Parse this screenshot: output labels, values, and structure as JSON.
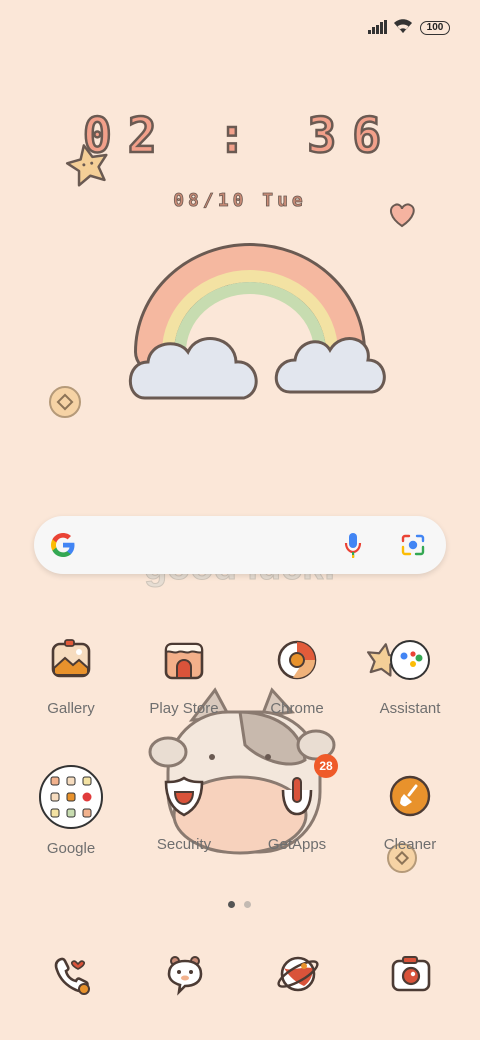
{
  "status_bar": {
    "battery": "100",
    "icons": [
      "signal-icon",
      "wifi-icon",
      "battery-icon"
    ]
  },
  "clock": {
    "time": "02 : 36",
    "date": "08/10 Tue"
  },
  "search": {
    "icons": [
      "google-g-icon",
      "microphone-icon",
      "lens-camera-icon"
    ]
  },
  "wallpaper": {
    "text": "good luck!"
  },
  "apps_row1": [
    {
      "label": "Gallery"
    },
    {
      "label": "Play Store"
    },
    {
      "label": "Chrome"
    },
    {
      "label": "Assistant"
    }
  ],
  "apps_row2": [
    {
      "label": "Google"
    },
    {
      "label": "Security"
    },
    {
      "label": "GetApps",
      "badge": "28"
    },
    {
      "label": "Cleaner"
    }
  ],
  "page_indicator": {
    "pages": 2,
    "current": 1
  },
  "dock": [
    {
      "icon": "phone-icon"
    },
    {
      "icon": "messages-icon"
    },
    {
      "icon": "browser-icon"
    },
    {
      "icon": "camera-icon"
    }
  ],
  "colors": {
    "background": "#fbe7d8",
    "accent": "#ef5a29",
    "outline": "#6a5a52",
    "cleaner": "#e8922c"
  }
}
